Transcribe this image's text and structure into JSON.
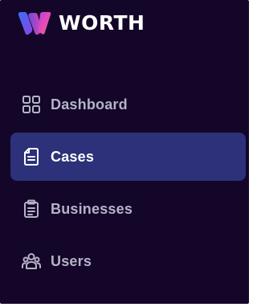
{
  "brand": {
    "name": "WORTH",
    "logo_icon": "worth-w-logo"
  },
  "sidebar": {
    "items": [
      {
        "label": "Dashboard",
        "icon": "grid-icon",
        "active": false
      },
      {
        "label": "Cases",
        "icon": "document-icon",
        "active": true
      },
      {
        "label": "Businesses",
        "icon": "clipboard-icon",
        "active": false
      },
      {
        "label": "Users",
        "icon": "users-icon",
        "active": false
      }
    ]
  },
  "colors": {
    "sidebar_background": "#130629",
    "active_item_background": "#2c3179",
    "active_text": "#ffffff",
    "inactive_text": "#b6b2c8",
    "logo_gradient": [
      "#3b6df0",
      "#c23be0",
      "#ff5f8f"
    ]
  }
}
